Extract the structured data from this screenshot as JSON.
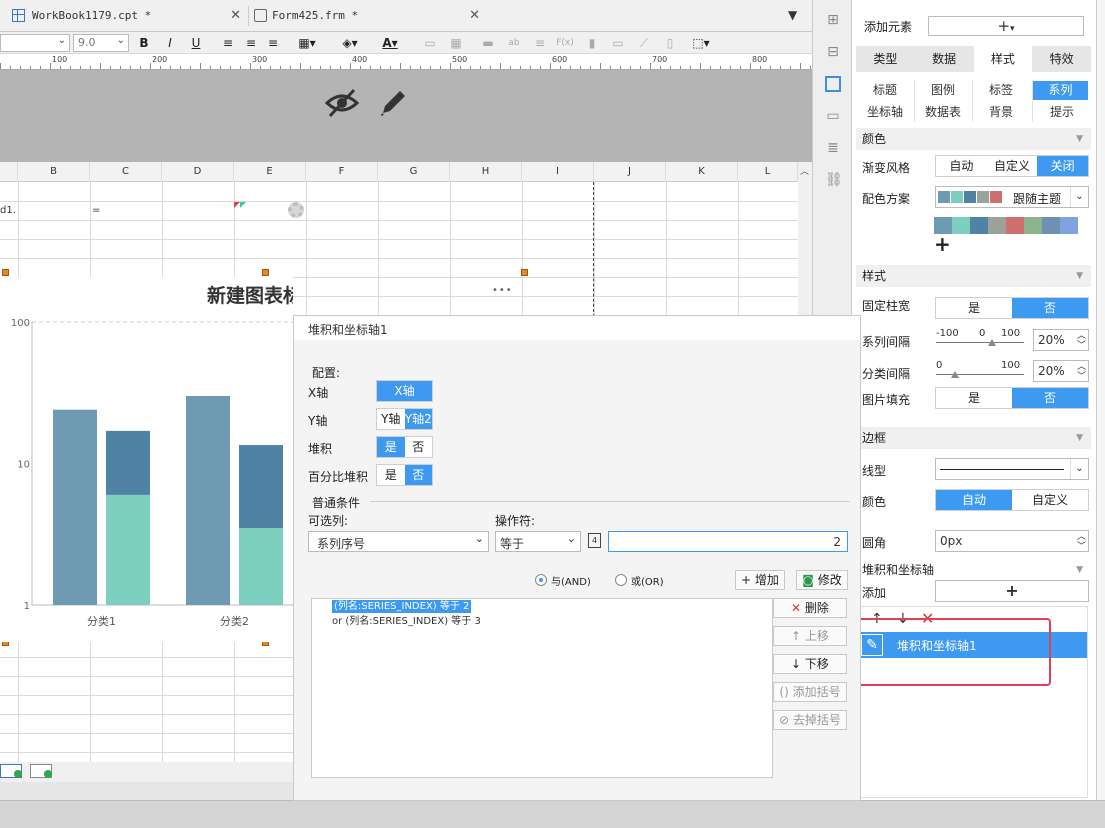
{
  "tabs": [
    {
      "label": "WorkBook1179.cpt *",
      "close": "✕"
    },
    {
      "label": "Form425.frm *",
      "close": "✕"
    }
  ],
  "toolbar": {
    "font_size": "9.0",
    "bold": "B",
    "italic": "I",
    "underline": "U",
    "text_color": "A"
  },
  "ruler": {
    "ticks": [
      "100",
      "200",
      "300",
      "400",
      "500",
      "600",
      "700",
      "800"
    ]
  },
  "columns": [
    "B",
    "C",
    "D",
    "E",
    "F",
    "G",
    "H",
    "I",
    "J",
    "K",
    "L"
  ],
  "cells": {
    "a1": "d1.",
    "c1": "=",
    "ellipsis": "•••"
  },
  "chart_data": {
    "type": "bar",
    "title": "新建图表标题",
    "categories": [
      "分类1",
      "分类2"
    ],
    "y_scale": "log",
    "ylim": [
      1,
      100
    ],
    "yticks": [
      "100",
      "10",
      "1"
    ],
    "series": [
      {
        "values": [
          24,
          30
        ],
        "color": "#6f9ab3"
      },
      {
        "values": [
          6,
          3.5
        ],
        "color": "#7ccfbe",
        "stack": "s"
      },
      {
        "values": [
          11,
          10
        ],
        "color": "#4f82a5",
        "stack": "s"
      }
    ]
  },
  "dialog": {
    "title": "堆积和坐标轴1",
    "config_label": "配置:",
    "x_axis_label": "X轴",
    "x_axis_value": "X轴",
    "y_axis_label": "Y轴",
    "y_axis_options": [
      "Y轴",
      "Y轴2"
    ],
    "stack_label": "堆积",
    "stack_options": [
      "是",
      "否"
    ],
    "percent_stack_label": "百分比堆积",
    "percent_stack_options": [
      "是",
      "否"
    ],
    "condition_section": "普通条件",
    "column_label": "可选列:",
    "column_value": "系列序号",
    "operator_label": "操作符:",
    "operator_value": "等于",
    "value": "2",
    "and_label": "与(AND)",
    "or_label": "或(OR)",
    "add_button": "增加",
    "modify_button": "修改",
    "delete_button": "删除",
    "up_button": "上移",
    "down_button": "下移",
    "add_bracket_button": "添加括号",
    "remove_bracket_button": "去掉括号",
    "conditions": [
      "(列名:SERIES_INDEX) 等于 2",
      "or  (列名:SERIES_INDEX) 等于 3"
    ]
  },
  "panel": {
    "add_element_label": "添加元素",
    "add_symbol": "+",
    "main_tabs": [
      "类型",
      "数据",
      "样式",
      "特效"
    ],
    "sub_tabs": [
      "标题",
      "图例",
      "标签",
      "系列",
      "坐标轴",
      "数据表",
      "背景",
      "提示"
    ],
    "color_section": "颜色",
    "gradient_label": "渐变风格",
    "gradient_options": [
      "自动",
      "自定义",
      "关闭"
    ],
    "scheme_label": "配色方案",
    "scheme_value": "跟随主题",
    "swatches": [
      "#6f9ab3",
      "#7ccfbe",
      "#4f82a5",
      "#9aa39a",
      "#d06f6f",
      "#8db38d",
      "#6f8fb3",
      "#7fa3e0"
    ],
    "style_section": "样式",
    "fixed_width_label": "固定柱宽",
    "yes_no": [
      "是",
      "否"
    ],
    "series_gap_label": "系列间隔",
    "series_gap_scale": [
      "-100",
      "0",
      "100"
    ],
    "series_gap_value": "20%",
    "category_gap_label": "分类间隔",
    "category_gap_scale": [
      "0",
      "100"
    ],
    "category_gap_value": "20%",
    "image_fill_label": "图片填充",
    "border_section": "边框",
    "line_type_label": "线型",
    "border_color_label": "颜色",
    "border_color_options": [
      "自动",
      "自定义"
    ],
    "radius_label": "圆角",
    "radius_value": "0px",
    "stack_section": "堆积和坐标轴",
    "add_label": "添加",
    "list_item": "堆积和坐标轴1"
  },
  "colors": {
    "accent": "#3d9af0",
    "highlight_border": "#e0405a"
  }
}
